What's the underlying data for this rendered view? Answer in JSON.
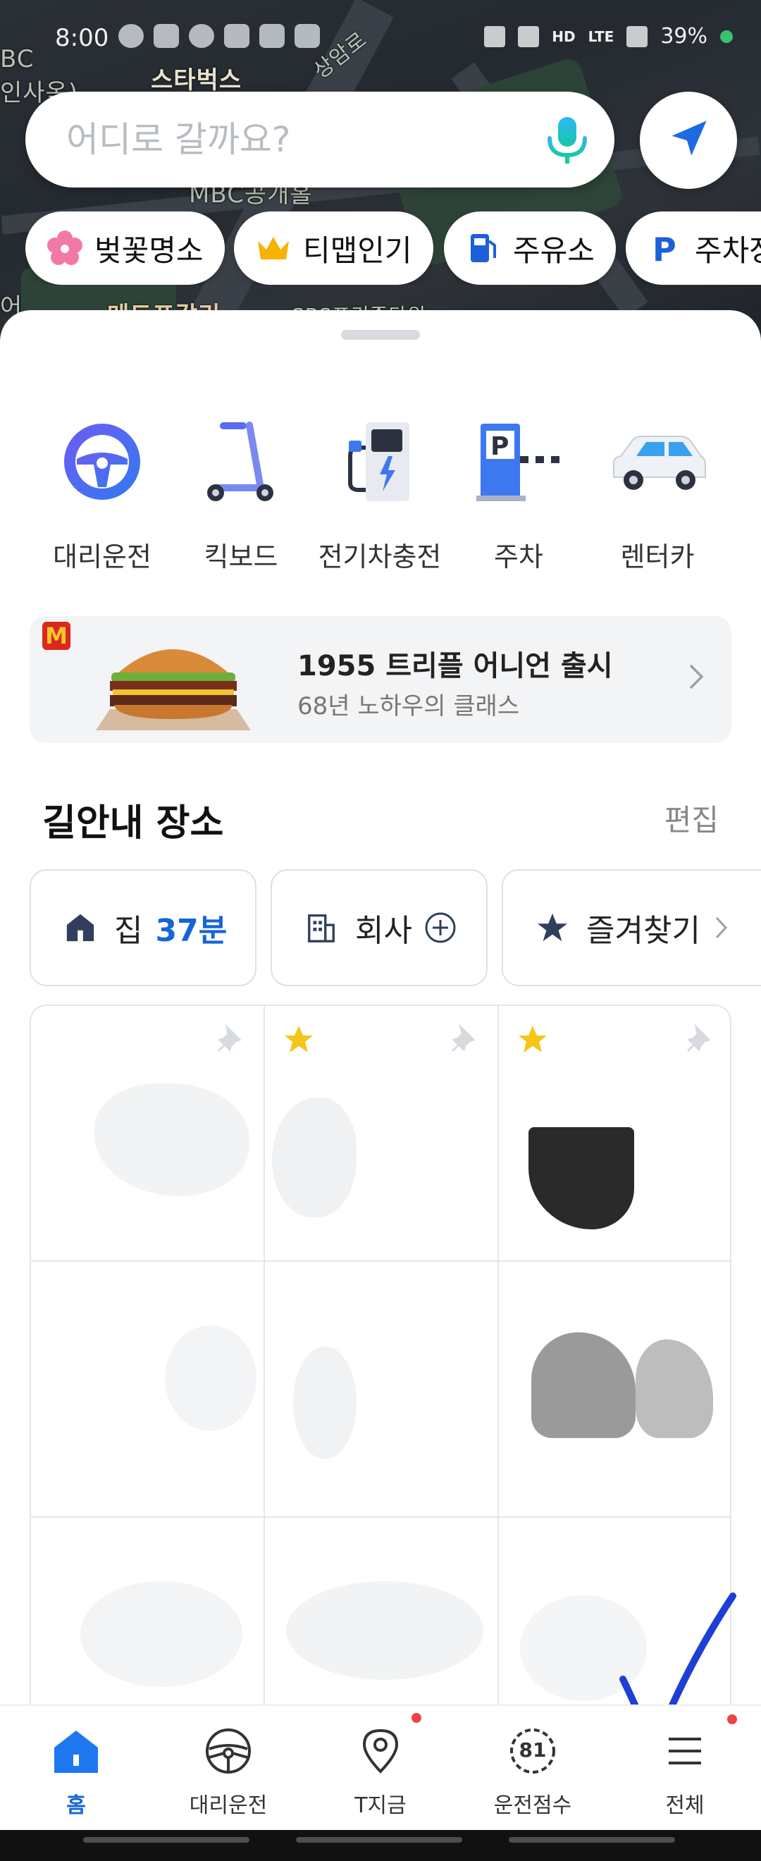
{
  "status_bar": {
    "time": "8:00",
    "battery": "39%",
    "network_badges": [
      "HD",
      "LTE"
    ]
  },
  "map": {
    "labels": [
      "BC",
      "인사옥)",
      "스타벅스",
      "상암로",
      "MBC공개홀",
      "어",
      "메드포갈리",
      "SBS프리즘타워"
    ]
  },
  "search": {
    "placeholder": "어디로 갈까요?",
    "value": ""
  },
  "chips": [
    {
      "label": "벚꽃명소",
      "icon": "cherry-blossom-icon"
    },
    {
      "label": "티맵인기",
      "icon": "crown-icon"
    },
    {
      "label": "주유소",
      "icon": "fuel-pump-icon"
    },
    {
      "label": "주차장",
      "icon": "parking-icon"
    }
  ],
  "services": [
    {
      "label": "대리운전",
      "icon": "steering-wheel-icon"
    },
    {
      "label": "킥보드",
      "icon": "kickboard-icon"
    },
    {
      "label": "전기차충전",
      "icon": "ev-charger-icon"
    },
    {
      "label": "주차",
      "icon": "parking-gate-icon"
    },
    {
      "label": "렌터카",
      "icon": "rental-car-icon"
    }
  ],
  "banner": {
    "title": "1955 트리플 어니언 출시",
    "subtitle": "68년 노하우의 클래스",
    "badge": "M"
  },
  "places_section": {
    "title": "길안내 장소",
    "edit_label": "편집"
  },
  "quick_places": {
    "home": {
      "label": "집",
      "eta": "37분"
    },
    "work": {
      "label": "회사"
    },
    "favorites": {
      "label": "즐겨찾기"
    }
  },
  "bottom_nav": [
    {
      "label": "홈",
      "icon": "home-icon",
      "active": true
    },
    {
      "label": "대리운전",
      "icon": "steering-wheel-icon",
      "active": false
    },
    {
      "label": "T지금",
      "icon": "location-pin-icon",
      "active": false,
      "dot": true
    },
    {
      "label": "운전점수",
      "icon": "score-gauge-icon",
      "active": false,
      "value": "81"
    },
    {
      "label": "전체",
      "icon": "menu-icon",
      "active": false,
      "dot": true
    }
  ],
  "colors": {
    "accent": "#1565d8",
    "star": "#f5c518",
    "notification": "#e44444"
  }
}
